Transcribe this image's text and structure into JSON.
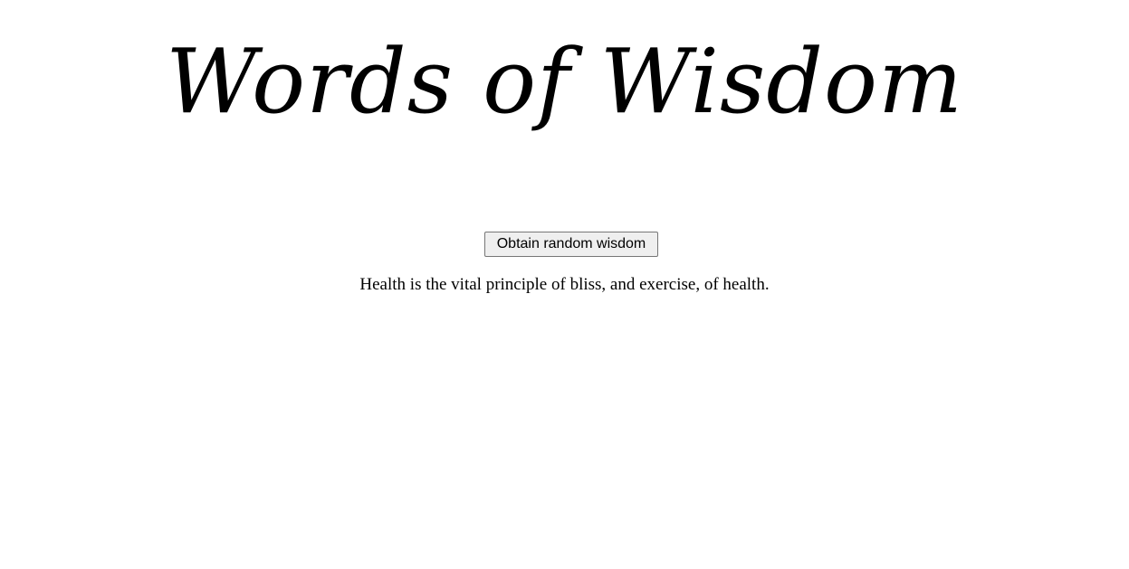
{
  "page": {
    "title": "Words of Wisdom",
    "button_label": "Obtain random wisdom",
    "quote": "Health is the vital principle of bliss, and exercise, of health."
  }
}
